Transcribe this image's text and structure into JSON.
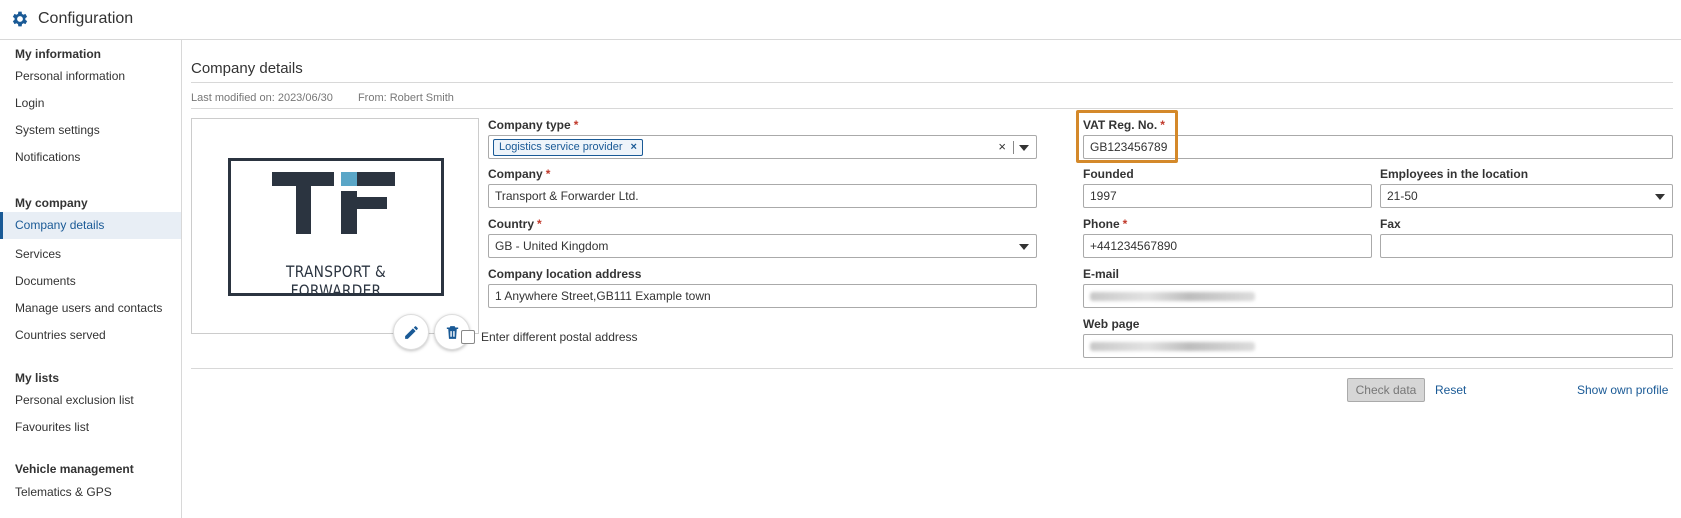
{
  "app": {
    "title": "Configuration",
    "icon": "gear-icon"
  },
  "colors": {
    "accent": "#1a5a96",
    "required": "#c0392b",
    "highlight": "#d4892a",
    "logo_dark": "#2b3440",
    "logo_accent": "#5aa6c7"
  },
  "sidebar": {
    "sections": [
      {
        "header": "My information",
        "items": [
          "Personal information",
          "Login",
          "System settings",
          "Notifications"
        ]
      },
      {
        "header": "My company",
        "items": [
          "Company details",
          "Services",
          "Documents",
          "Manage users and contacts",
          "Countries served"
        ]
      },
      {
        "header": "My lists",
        "items": [
          "Personal exclusion list",
          "Favourites list"
        ]
      },
      {
        "header": "Vehicle management",
        "items": [
          "Telematics & GPS"
        ]
      }
    ],
    "active_item": "Company details"
  },
  "page": {
    "title": "Company details",
    "last_modified": "Last modified on: 2023/06/30",
    "modified_by": "From: Robert Smith"
  },
  "logo": {
    "initials": "TF",
    "text": "TRANSPORT & FORWARDER",
    "edit_icon": "pencil-icon",
    "delete_icon": "trash-icon"
  },
  "form": {
    "company_type": {
      "label": "Company type",
      "required": "*",
      "tag": "Logistics service provider",
      "tag_remove": "×",
      "clear": "×"
    },
    "vat": {
      "label": "VAT Reg. No.",
      "required": "*",
      "value": "GB123456789"
    },
    "company": {
      "label": "Company",
      "required": "*",
      "value": "Transport & Forwarder Ltd."
    },
    "founded": {
      "label": "Founded",
      "value": "1997"
    },
    "employees": {
      "label": "Employees in the location",
      "value": "21-50"
    },
    "country": {
      "label": "Country",
      "required": "*",
      "value": "GB - United Kingdom"
    },
    "phone": {
      "label": "Phone",
      "required": "*",
      "value": "+441234567890"
    },
    "fax": {
      "label": "Fax",
      "value": ""
    },
    "address": {
      "label": "Company location address",
      "value": "1 Anywhere Street,GB111 Example town"
    },
    "email": {
      "label": "E-mail"
    },
    "web": {
      "label": "Web page"
    },
    "postal": {
      "label": "Enter different postal address"
    }
  },
  "actions": {
    "check": "Check data",
    "reset": "Reset",
    "show_profile": "Show own profile"
  }
}
